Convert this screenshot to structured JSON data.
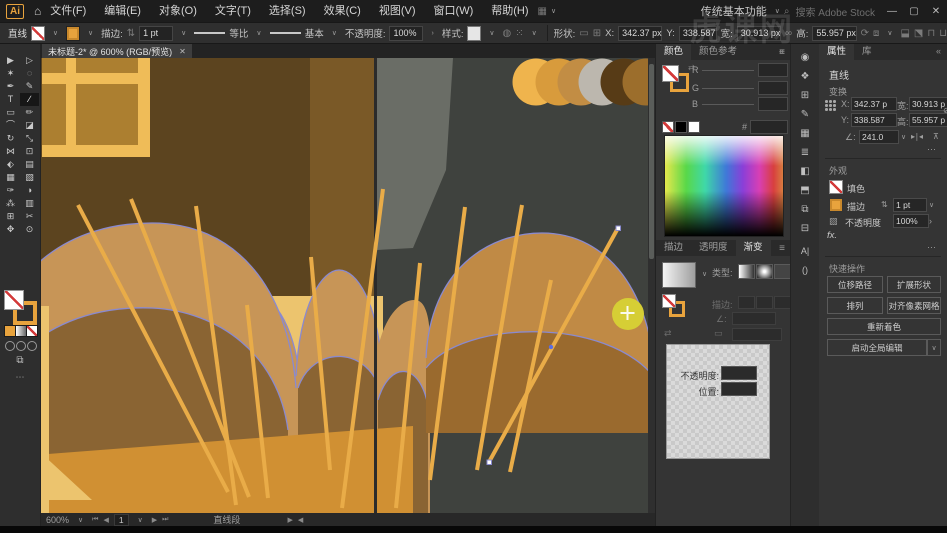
{
  "window": {
    "minimize": "—",
    "restore": "▢",
    "close": "✕",
    "watermark": "虎课网"
  },
  "icons": {
    "chev": "∨",
    "chev_right": "›",
    "stepper": "⇅",
    "link": "∞",
    "unlink": "⊘",
    "menu": "≡",
    "swap": "⇄",
    "more": "···",
    "flip_h": "▸∣◂",
    "flip_v": "⊼",
    "globe": "◍",
    "align": "⁙",
    "home": "⌂",
    "search": "⌕",
    "collapse": "«",
    "angle": "∠:",
    "grid": "⊞",
    "shape_rect": "▭",
    "opacity_mask": "▨",
    "arrow_left": "◀",
    "arrow_right": "▶",
    "first": "⏮",
    "last": "⏭"
  },
  "menu_bar": {
    "logo": "Ai",
    "items": [
      "文件(F)",
      "编辑(E)",
      "对象(O)",
      "文字(T)",
      "选择(S)",
      "效果(C)",
      "视图(V)",
      "窗口(W)",
      "帮助(H)"
    ],
    "layout_icon": "▦",
    "workspace": "传统基本功能",
    "search_placeholder": "搜索 Adobe Stock"
  },
  "control_bar": {
    "tool": "直线",
    "stroke_label": "描边:",
    "stroke_value": "1 pt",
    "profile": "等比",
    "brush": "基本",
    "opacity_label": "不透明度:",
    "opacity_value": "100%",
    "style_label": "样式:",
    "shape_label": "形状:",
    "x_label": "X:",
    "x_value": "342.37 px",
    "y_label": "Y:",
    "y_value": "338.587",
    "w_label": "宽:",
    "w_value": "30.913 px",
    "h_label": "高:",
    "h_value": "55.957 px",
    "extra_icons": [
      "⟳",
      "⧈",
      "⬓",
      "⬔",
      "⊓",
      "⊔"
    ]
  },
  "document_tab": {
    "title": "未标题-2* @ 600% (RGB/预览)"
  },
  "toolbar": {
    "glyphs": [
      "▶",
      "▷",
      "✶",
      "◌",
      "✒",
      "✎",
      "T",
      "∕",
      "▭",
      "✏",
      "⌒",
      "◪",
      "↻",
      "⤡",
      "⋈",
      "⊡",
      "⬖",
      "▤",
      "▦",
      "▧",
      "✑",
      "◑",
      "⁂",
      "▥",
      "⊞",
      "✂",
      "✥",
      "⊙"
    ],
    "more": "⋯"
  },
  "canvas": {
    "colors": {
      "pasteboard": "#3F423E",
      "wall": "#5C441F",
      "wall_band": "#7A5927",
      "frame": "#EFBC58",
      "pane": "#AC7F30",
      "light_wedge": "#6A6D66",
      "dome_tan": "#C79557",
      "dome_dark": "#8A6433",
      "dome_tan_right": "#C08A45",
      "dome_dark_right": "#9A6A2E",
      "floor": "#D09033",
      "floor_light": "#ECC46E",
      "stick": "#E9AC48",
      "circle_yellow": "#D6CE35",
      "selection": "#8A8ACF",
      "divider": "#2B2B2B",
      "scroll_thumb": "#5A5D5A",
      "swatch_circles": [
        "#EFB44D",
        "#D89B3C",
        "#C28D44",
        "#BCB7AE",
        "#573B16",
        "#9C6E2C"
      ]
    }
  },
  "status_bar": {
    "zoom": "600%",
    "artboard": "1",
    "tool_name": "直线段"
  },
  "panels": {
    "color": {
      "tabs": [
        "颜色",
        "颜色参考"
      ],
      "r": "R",
      "g": "G",
      "b": "B",
      "hex": "#"
    },
    "gradient": {
      "tabs": [
        "描边",
        "透明度",
        "渐变"
      ],
      "type_label": "类型:",
      "stroke_label": "描边:",
      "opacity_label": "不透明度:",
      "position_label": "位置:"
    },
    "dock_icons": [
      "◉",
      "❖",
      "⊞",
      "✎",
      "▦",
      "≣",
      "◧",
      "⬒",
      "⧉",
      "⊟",
      "A|",
      "()"
    ],
    "properties": {
      "tabs": [
        "属性",
        "库"
      ],
      "object_name": "直线",
      "transform_label": "变换",
      "x_label": "X:",
      "x_value": "342.37 p",
      "y_label": "Y:",
      "y_value": "338.587",
      "w_label": "宽:",
      "w_value": "30.913 p",
      "h_label": "高:",
      "h_value": "55.957 p",
      "angle_value": "241.0",
      "appearance_label": "外观",
      "fill_label": "填色",
      "stroke_label": "描边",
      "stroke_value": "1 pt",
      "opacity_label": "不透明度",
      "opacity_value": "100%",
      "fx": "fx.",
      "quick_label": "快速操作",
      "buttons": [
        "位移路径",
        "扩展形状",
        "排列",
        "对齐像素网格",
        "重新着色",
        "启动全局编辑"
      ]
    }
  }
}
